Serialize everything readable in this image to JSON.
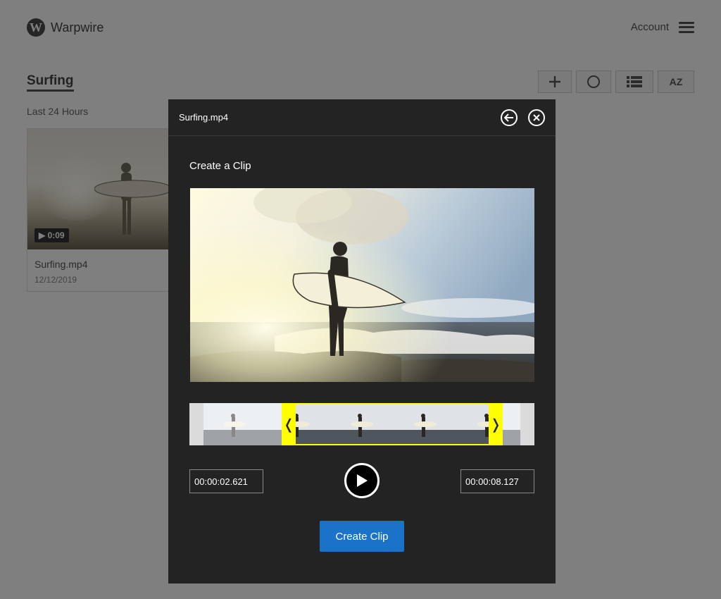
{
  "app": {
    "brand": "Warpwire",
    "logo_letter": "W"
  },
  "header": {
    "account_label": "Account",
    "menu_icon": "hamburger-menu-icon"
  },
  "page": {
    "title": "Surfing",
    "section_label": "Last 24 Hours",
    "toolbar": [
      {
        "name": "add-icon"
      },
      {
        "name": "circle-icon"
      },
      {
        "name": "list-view-icon"
      },
      {
        "name": "sort-az-icon",
        "label": "AZ"
      }
    ],
    "media_card": {
      "title": "Surfing.mp4",
      "date": "12/12/2019",
      "duration": "▶ 0:09"
    }
  },
  "modal": {
    "filename": "Surfing.mp4",
    "heading": "Create a Clip",
    "start_time": "00:00:02.621",
    "end_time": "00:00:08.127",
    "create_button": "Create Clip",
    "handle_left_glyph": "❬",
    "handle_right_glyph": "❭"
  },
  "colors": {
    "accent": "#1a73c8",
    "selection": "#ffff00",
    "modal_bg": "#232323"
  }
}
